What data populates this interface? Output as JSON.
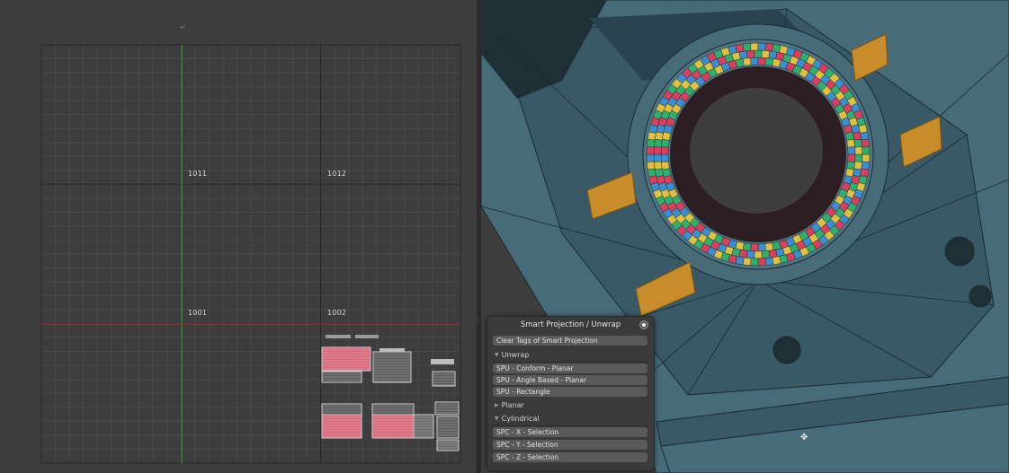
{
  "uv_editor": {
    "top_mark": "↵",
    "tiles": [
      "1011",
      "1012",
      "1001",
      "1002"
    ],
    "colors": {
      "background": "#3d3d3d",
      "grid_minor": "#4a4a4a",
      "grid_major": "#262626",
      "v_axis": "#3fb43f",
      "u_axis": "#b03030"
    }
  },
  "splitter": {
    "grip": "⋮"
  },
  "viewport": {
    "colors": {
      "mesh": "#476b78",
      "mesh_dark": "#3a5966",
      "hole": "#1e2f36",
      "wire": "#1a2a30",
      "uv_checker": [
        "#d94060",
        "#3a8fd0",
        "#e0c040",
        "#30b070"
      ],
      "orange_block": "#c88d2a"
    },
    "cursor_icon": "✥"
  },
  "panel": {
    "title": "Smart Projection / Unwrap",
    "close_icon": "close-icon",
    "clear_tags": "Clear Tags of Smart Projection",
    "sections": {
      "unwrap": "Unwrap",
      "planar": "Planar",
      "cylindrical": "Cylindrical"
    },
    "unwrap_buttons": [
      "SPU - Conform - Planar",
      "SPU - Angle Based - Planar",
      "SPU - Rectangle"
    ],
    "cylindrical_buttons": [
      "SPC - X - Selection",
      "SPC - Y - Selection",
      "SPC - Z - Selection"
    ],
    "expanded_arrow": "▼",
    "collapsed_arrow": "▶"
  }
}
